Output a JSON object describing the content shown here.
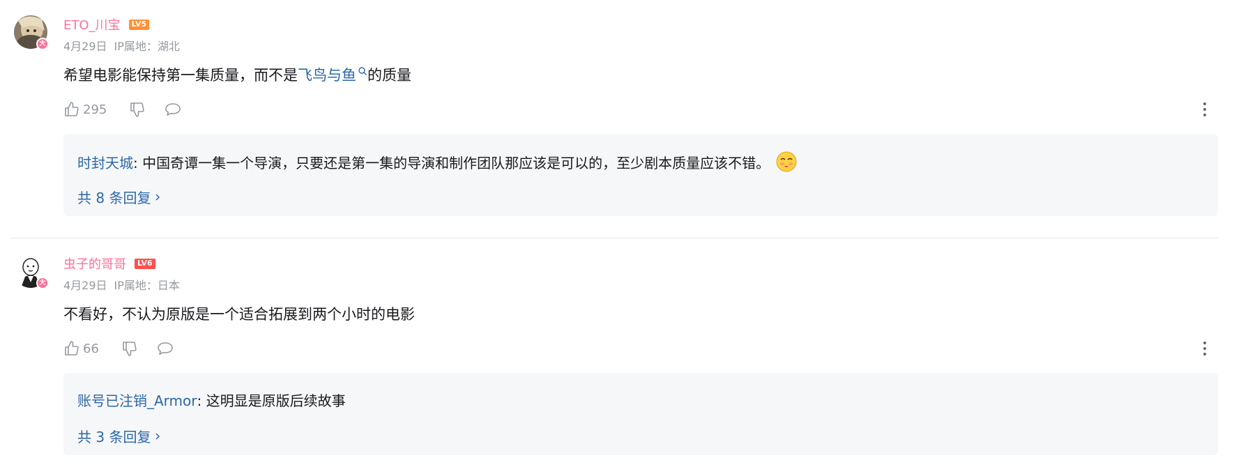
{
  "comments": [
    {
      "username": "ETO_川宝",
      "level": "LV5",
      "date": "4月29日",
      "ip_location": "IP属地：湖北",
      "text_before": "希望电影能保持第一集质量，而不是",
      "keyword": "飞鸟与鱼",
      "text_after": "的质量",
      "likes": "295",
      "reply_preview_user": "时封天城",
      "reply_preview_text": ": 中国奇谭一集一个导演，只要还是第一集的导演和制作团队那应该是可以的，至少剧本质量应该不错。",
      "reply_count_label": "共 8 条回复"
    },
    {
      "username": "虫子的哥哥",
      "level": "LV6",
      "date": "4月29日",
      "ip_location": "IP属地：日本",
      "text": "不看好，不认为原版是一个适合拓展到两个小时的电影",
      "likes": "66",
      "reply_preview_user": "账号已注销_Armor",
      "reply_preview_text": ": 这明显是原版后续故事",
      "reply_count_label": "共 3 条回复"
    }
  ],
  "badge_char": "大",
  "colors": {
    "username": "#fb7299",
    "link": "#2a67a8",
    "meta": "#9499a0",
    "reply_bg": "#f6f7f8"
  }
}
